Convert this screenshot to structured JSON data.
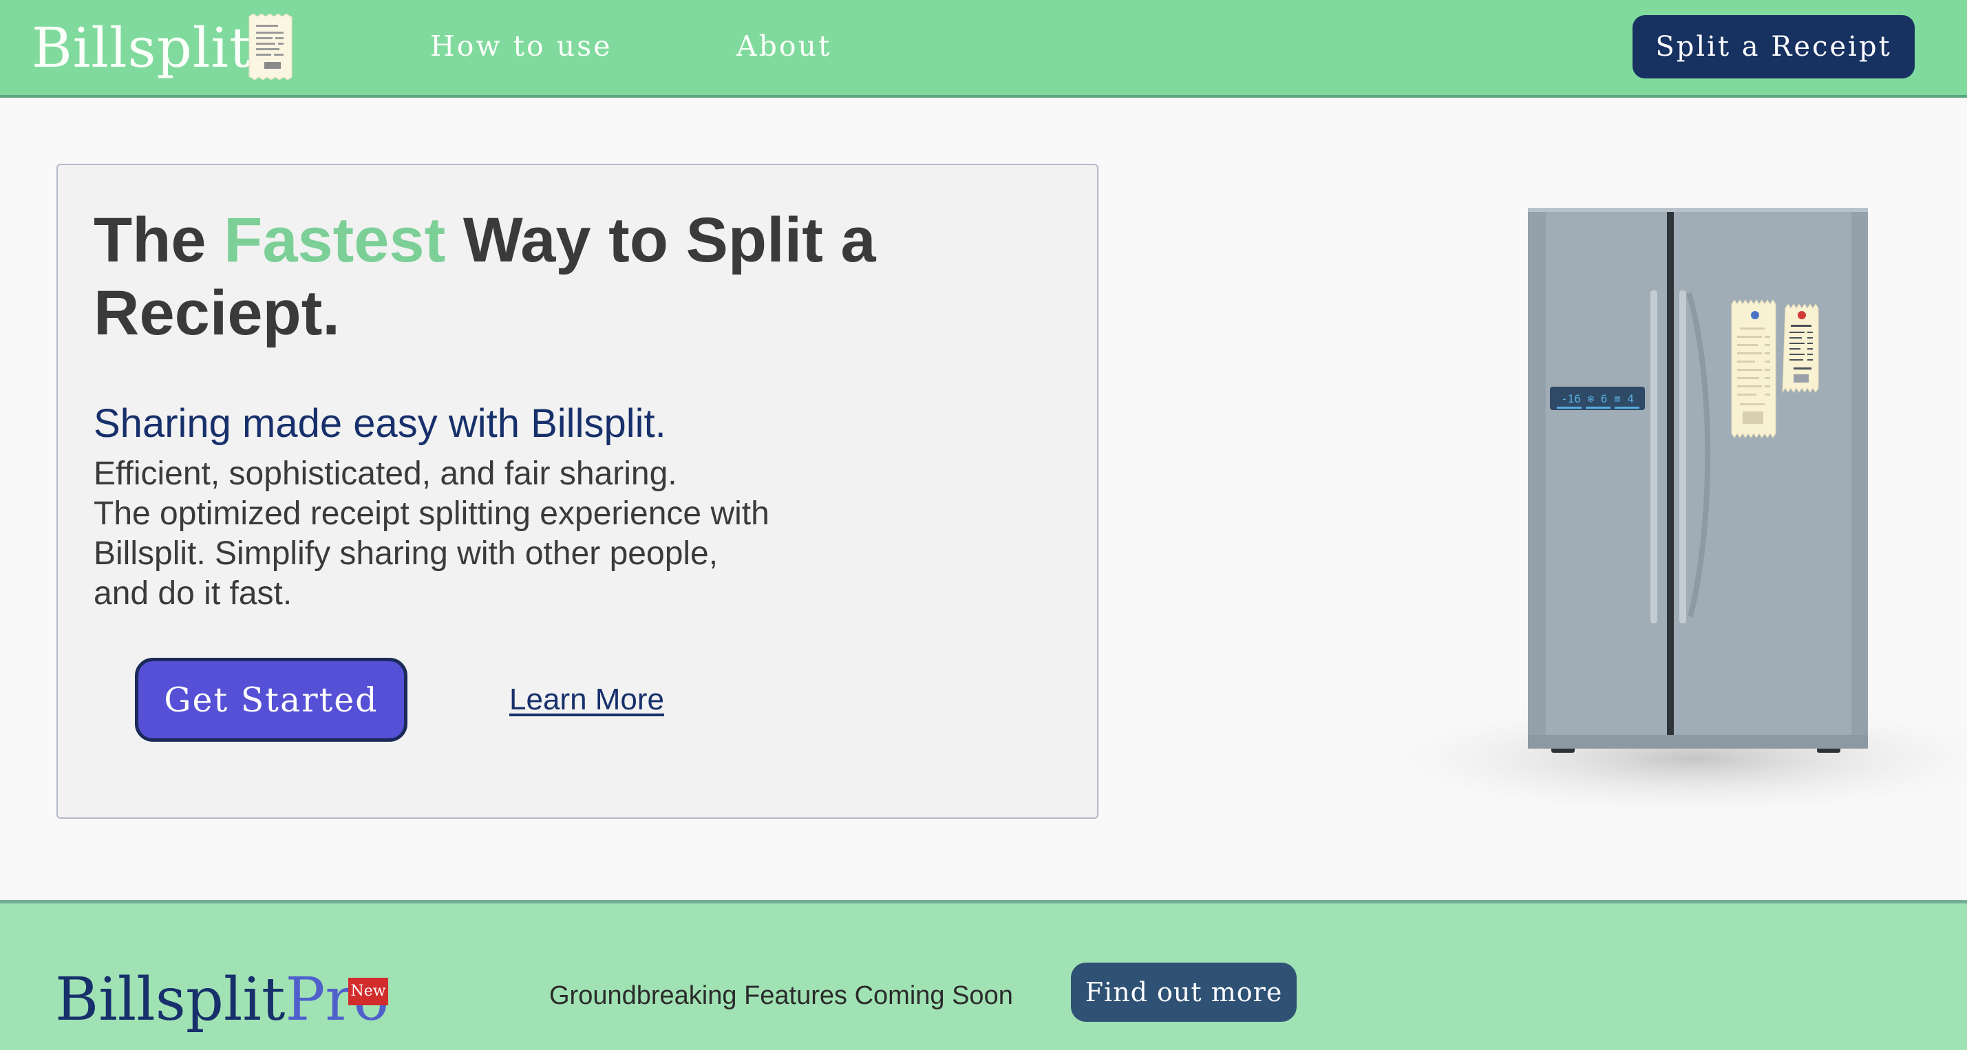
{
  "header": {
    "logo": "Billsplit",
    "logo_icon": "receipt-icon",
    "nav": [
      {
        "label": "How to use"
      },
      {
        "label": "About"
      }
    ],
    "cta_label": "Split a Receipt"
  },
  "hero": {
    "headline_pre": "The ",
    "headline_accent": "Fastest",
    "headline_post": " Way to Split a Reciept.",
    "subhead": "Sharing made easy with Billsplit.",
    "body_lines": [
      "Efficient, sophisticated, and fair sharing.",
      "The optimized receipt splitting experience with",
      "Billsplit. Simplify sharing with other people,",
      "and do it fast."
    ],
    "primary_button": "Get Started",
    "secondary_link": "Learn More"
  },
  "illustration": {
    "icon": "refrigerator-icon",
    "display": "-16 ❄ 6 ≡ 4"
  },
  "promo": {
    "logo_main": "Billsplit",
    "logo_accent": "Pro",
    "badge": "New",
    "text": "Groundbreaking Features Coming Soon",
    "button": "Find out more"
  },
  "colors": {
    "header_bg": "#80da9d",
    "navy": "#17306b",
    "accent_green": "#7ccf96",
    "primary_button": "#5650d6",
    "footer_bg": "#a0e2b4",
    "badge_red": "#d22c2c"
  }
}
